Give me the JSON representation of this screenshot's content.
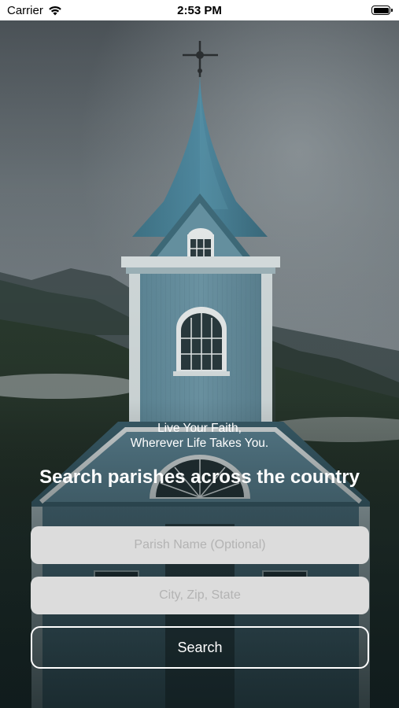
{
  "status_bar": {
    "carrier": "Carrier",
    "time": "2:53 PM",
    "icons": [
      "wifi-icon",
      "battery-icon"
    ]
  },
  "hero": {
    "tagline_line1": "Live Your Faith,",
    "tagline_line2": "Wherever Life Takes You.",
    "headline": "Search parishes across the country",
    "background_image": "church-steeple-photo"
  },
  "search_form": {
    "parish_placeholder": "Parish Name (Optional)",
    "location_placeholder": "City, Zip, State",
    "search_label": "Search"
  },
  "colors": {
    "field_background": "#dcdcdc",
    "placeholder_text": "#b3b3b3",
    "text_primary": "#ffffff",
    "church_blue": "#6a9aab"
  }
}
